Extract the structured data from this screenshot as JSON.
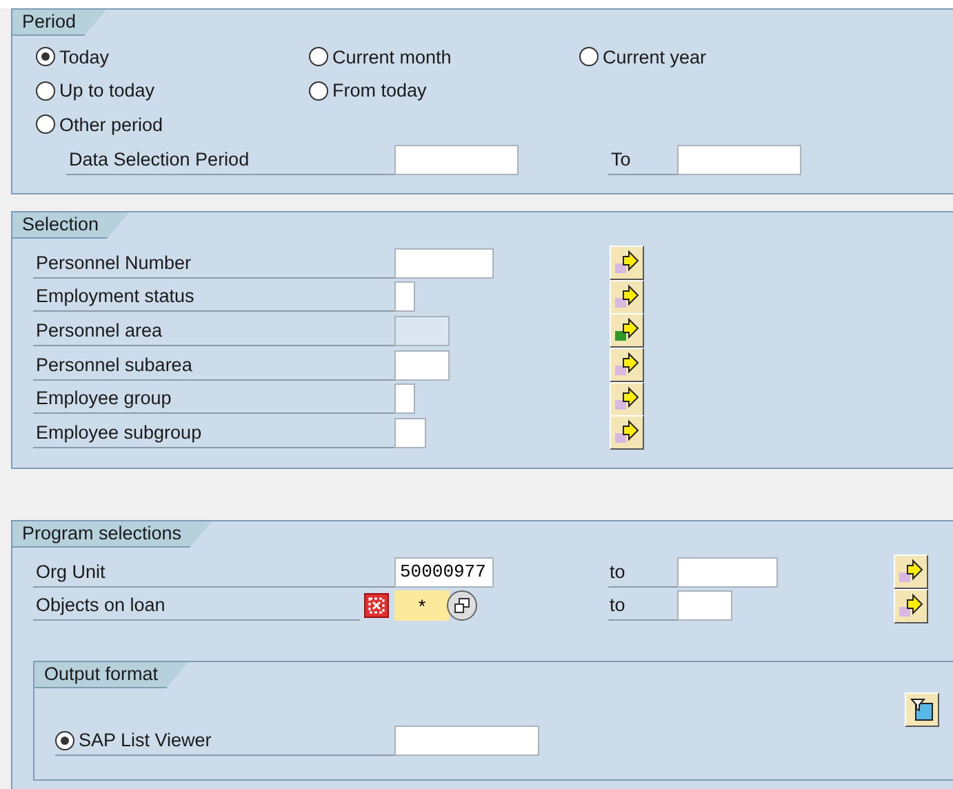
{
  "period": {
    "title": "Period",
    "option_rows": [
      {
        "options": [
          {
            "label": "Today",
            "selected": true
          },
          {
            "label": "Current month",
            "selected": false
          },
          {
            "label": "Current year",
            "selected": false
          }
        ]
      },
      {
        "options": [
          {
            "label": "Up to today",
            "selected": false
          },
          {
            "label": "From today",
            "selected": false
          }
        ]
      },
      {
        "options": [
          {
            "label": "Other period",
            "selected": false
          }
        ]
      }
    ],
    "range": {
      "label": "Data Selection Period",
      "to_label": "To"
    }
  },
  "selection": {
    "title": "Selection",
    "rows": [
      {
        "label": "Personnel Number",
        "disabled": false,
        "has_selection": false
      },
      {
        "label": "Employment status",
        "disabled": false,
        "has_selection": false
      },
      {
        "label": "Personnel area",
        "disabled": true,
        "has_selection": true
      },
      {
        "label": "Personnel subarea",
        "disabled": false,
        "has_selection": false
      },
      {
        "label": "Employee group",
        "disabled": false,
        "has_selection": false
      },
      {
        "label": "Employee subgroup",
        "disabled": false,
        "has_selection": false
      }
    ]
  },
  "program_selections": {
    "title": "Program selections",
    "rows": [
      {
        "kind": "normal",
        "label": "Org Unit",
        "value": "50000977",
        "to_label": "to"
      },
      {
        "kind": "required",
        "label": "Objects on loan",
        "value": "*",
        "to_label": "to"
      }
    ],
    "output_format": {
      "title": "Output format",
      "options": [
        {
          "label": "SAP List Viewer",
          "selected": true
        }
      ]
    }
  }
}
